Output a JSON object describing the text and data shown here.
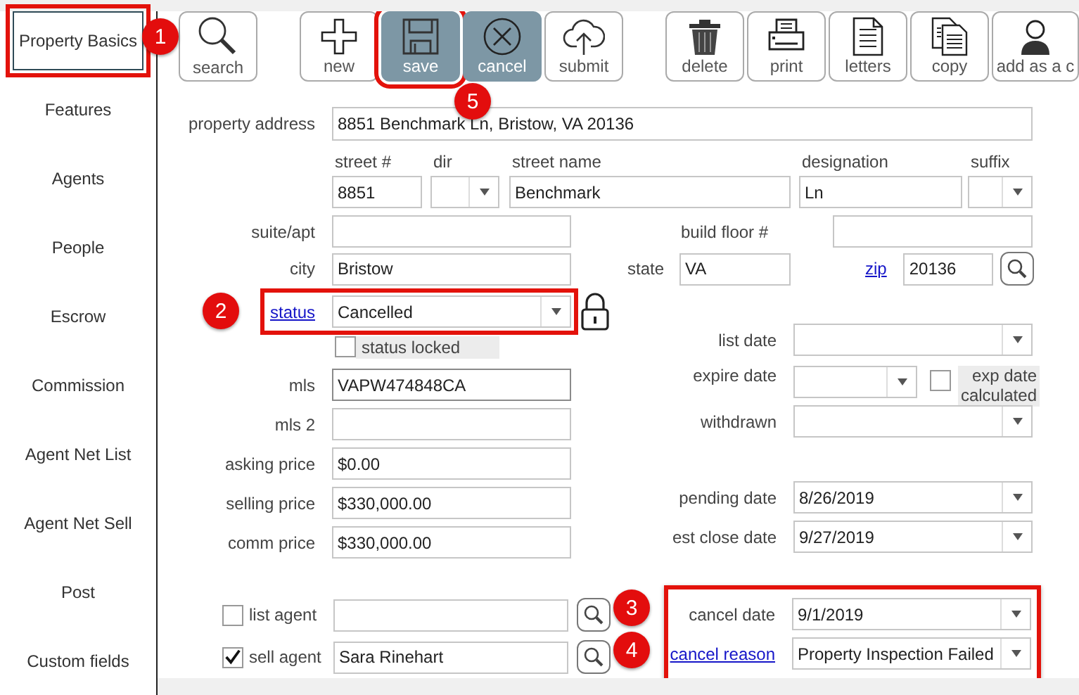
{
  "sidebar": {
    "items": [
      {
        "label": "Property Basics",
        "selected": true,
        "highlighted": true,
        "callout": "1"
      },
      {
        "label": "Features",
        "selected": false
      },
      {
        "label": "Agents",
        "selected": false
      },
      {
        "label": "People",
        "selected": false
      },
      {
        "label": "Escrow",
        "selected": false
      },
      {
        "label": "Commission",
        "selected": false
      },
      {
        "label": "Agent Net List",
        "selected": false
      },
      {
        "label": "Agent Net Sell",
        "selected": false
      },
      {
        "label": "Post",
        "selected": false
      },
      {
        "label": "Custom fields",
        "selected": false
      }
    ]
  },
  "toolbar": {
    "groups": [
      [
        {
          "label": "search",
          "active": false
        }
      ],
      [
        {
          "label": "new",
          "active": false
        },
        {
          "label": "save",
          "active": true,
          "highlighted": true,
          "callout": "5"
        },
        {
          "label": "cancel",
          "active": true
        },
        {
          "label": "submit",
          "active": false
        }
      ],
      [
        {
          "label": "delete",
          "active": false
        },
        {
          "label": "print",
          "active": false
        },
        {
          "label": "letters",
          "active": false
        },
        {
          "label": "copy",
          "active": false
        },
        {
          "label": "add as a c",
          "active": false
        }
      ]
    ]
  },
  "form": {
    "property_address": {
      "label": "property address",
      "value": "8851 Benchmark Ln, Bristow, VA 20136"
    },
    "street": [
      {
        "label": "street #",
        "value": "8851",
        "kind": "text"
      },
      {
        "label": "dir",
        "kind": "dropdown"
      },
      {
        "label": "street name",
        "value": "Benchmark",
        "kind": "text"
      },
      {
        "label": "designation",
        "value": "Ln",
        "kind": "text"
      },
      {
        "label": "suffix",
        "kind": "dropdown"
      }
    ],
    "suite_apt": {
      "label": "suite/apt"
    },
    "build_floor": {
      "label": "build floor #"
    },
    "city": {
      "label": "city",
      "value": "Bristow"
    },
    "state": {
      "label": "state",
      "value": "VA"
    },
    "zip": {
      "label": "zip",
      "value": "20136"
    },
    "status": {
      "label": "status",
      "value": "Cancelled",
      "highlighted": true,
      "callout": "2"
    },
    "status_locked": {
      "label": "status locked",
      "checked": false
    },
    "mls": {
      "label": "mls",
      "value": "VAPW474848CA"
    },
    "mls_2": {
      "label": "mls 2"
    },
    "asking_price": {
      "label": "asking price",
      "value": "$0.00"
    },
    "selling_price": {
      "label": "selling price",
      "value": "$330,000.00"
    },
    "comm_price": {
      "label": "comm price",
      "value": "$330,000.00"
    },
    "list_date": {
      "label": "list date"
    },
    "expire_date": {
      "label": "expire date"
    },
    "exp_date_calculated": {
      "label": "exp date calculated",
      "checked": false
    },
    "withdrawn": {
      "label": "withdrawn"
    },
    "pending_date": {
      "label": "pending date",
      "value": "8/26/2019"
    },
    "est_close_date": {
      "label": "est close date",
      "value": "9/27/2019"
    },
    "list_agent": {
      "label": "list agent",
      "checked": false,
      "callout": "3"
    },
    "sell_agent": {
      "label": "sell agent",
      "checked": true,
      "value": "Sara Rinehart",
      "callout": "4"
    },
    "cancel_section": {
      "highlighted": true,
      "cancel_date": {
        "label": "cancel date",
        "value": "9/1/2019"
      },
      "cancel_reason": {
        "label": "cancel reason",
        "value": "Property Inspection Failed"
      }
    }
  }
}
